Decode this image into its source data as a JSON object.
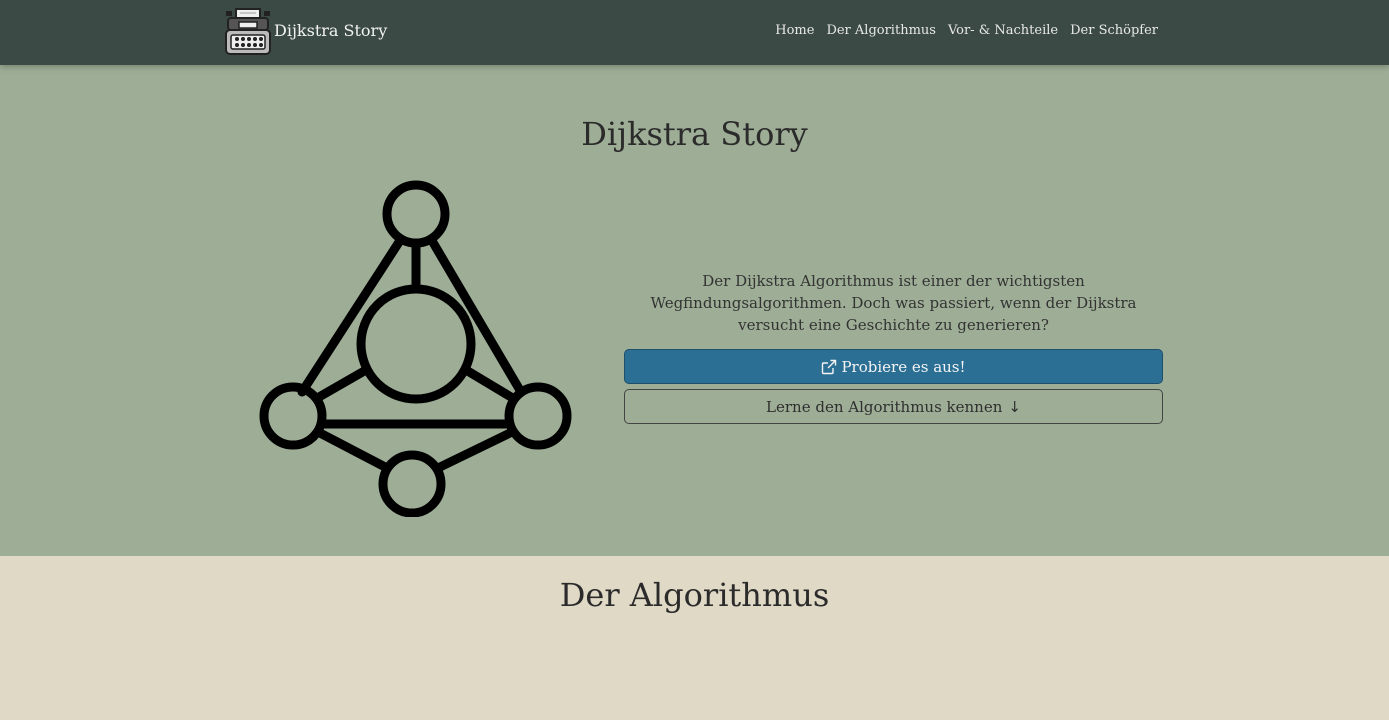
{
  "navbar": {
    "brand": "Dijkstra Story",
    "brand_logo_icon": "typewriter-icon",
    "links": [
      "Home",
      "Der Algorithmus",
      "Vor- & Nachteile",
      "Der Schöpfer"
    ]
  },
  "hero": {
    "title": "Dijkstra Story",
    "graph_icon": "graph-network-icon",
    "description": "Der Dijkstra Algorithmus ist einer der wichtigsten Wegfindungsalgorithmen. Doch was passiert, wenn der Dijkstra versucht eine Geschichte zu generieren?",
    "primary_button": {
      "label": "Probiere es aus!",
      "icon": "external-link-icon"
    },
    "secondary_button": {
      "label": "Lerne den Algorithmus kennen",
      "icon": "arrow-down-icon",
      "arrow": "↓"
    }
  },
  "section": {
    "title": "Der Algorithmus"
  },
  "colors": {
    "navbar_bg": "#3b4a45",
    "hero_bg": "#9eae96",
    "section_bg": "#e0d9c6",
    "primary_button": "#2c6f94"
  }
}
